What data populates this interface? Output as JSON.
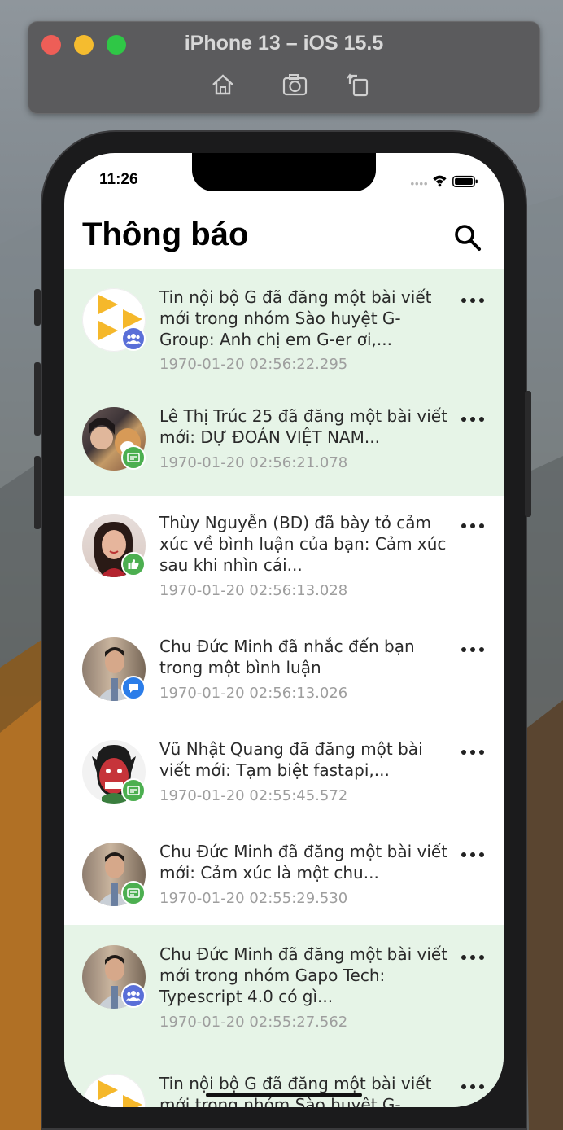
{
  "simulator": {
    "title": "iPhone 13 – iOS 15.5",
    "buttons": [
      "home-icon",
      "screenshot-icon",
      "rotate-icon"
    ]
  },
  "status_bar": {
    "time": "11:26"
  },
  "header": {
    "title": "Thông báo"
  },
  "colors": {
    "unread_bg": "#e6f4e7",
    "badge_green": "#4caf50",
    "badge_blue": "#2b7de9",
    "badge_purple": "#5a6fd8"
  },
  "notifications": [
    {
      "text": "Tin nội bộ G đã đăng một bài viết mới trong nhóm Sào huyệt G-Group: Anh chị em G-er ơi,...",
      "time": "1970-01-20 02:56:22.295",
      "unread": true,
      "badge": "group-icon"
    },
    {
      "text": "Lê Thị Trúc 25 đã đăng một bài viết mới: DỰ ĐOÁN VIỆT NAM...",
      "time": "1970-01-20 02:56:21.078",
      "unread": true,
      "badge": "post-icon"
    },
    {
      "text": "Thùy Nguyễn (BD) đã bày tỏ cảm xúc về bình luận của bạn: Cảm xúc sau khi nhìn cái...",
      "time": "1970-01-20 02:56:13.028",
      "unread": false,
      "badge": "like-icon"
    },
    {
      "text": "Chu Đức Minh đã nhắc đến bạn trong một bình luận",
      "time": "1970-01-20 02:56:13.026",
      "unread": false,
      "badge": "comment-icon"
    },
    {
      "text": "Vũ Nhật Quang đã đăng một bài viết mới: Tạm biệt fastapi,...",
      "time": "1970-01-20 02:55:45.572",
      "unread": false,
      "badge": "post-icon"
    },
    {
      "text": "Chu Đức Minh đã đăng một bài viết mới: Cảm xúc là một chu...",
      "time": "1970-01-20 02:55:29.530",
      "unread": false,
      "badge": "post-icon"
    },
    {
      "text": "Chu Đức Minh đã đăng một bài viết mới trong nhóm Gapo Tech: Typescript 4.0 có gì...",
      "time": "1970-01-20 02:55:27.562",
      "unread": true,
      "badge": "group-icon"
    },
    {
      "text": "Tin nội bộ G đã đăng một bài viết mới trong nhóm Sào huyệt G-",
      "time": "",
      "unread": true,
      "badge": "group-icon"
    }
  ]
}
